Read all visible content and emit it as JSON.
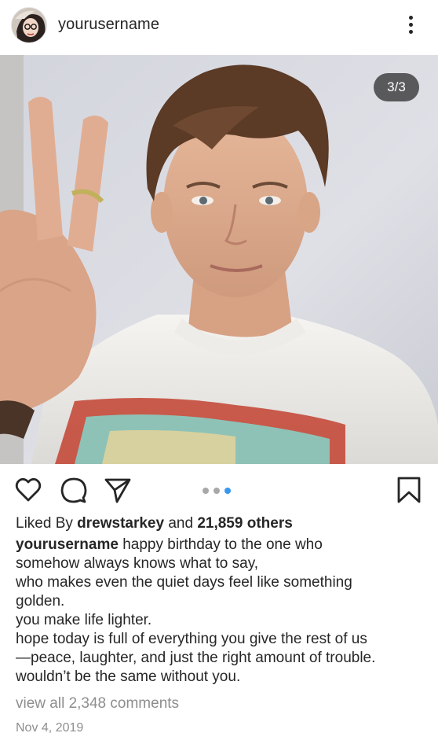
{
  "header": {
    "username": "yourusername"
  },
  "post": {
    "counter": "3/3",
    "carousel": {
      "total": 3,
      "active": 3
    }
  },
  "likes": {
    "prefix": "Liked By",
    "user": "drewstarkey",
    "connector": "and",
    "others": "21,859 others"
  },
  "caption": {
    "username": "yourusername",
    "lines": [
      "happy birthday to the one who",
      "somehow always knows what to say,",
      "who makes even the quiet days feel like something",
      "golden.",
      "you make life lighter.",
      "hope today is full of everything you give the rest of us",
      "—peace, laughter, and just the right amount of trouble.",
      "wouldn’t be the same without you."
    ]
  },
  "comments_link": "view all 2,348 comments",
  "date": "Nov 4, 2019",
  "icons": {
    "more": "more-vertical-icon",
    "like": "heart-icon",
    "comment": "comment-icon",
    "share": "send-icon",
    "save": "bookmark-icon"
  },
  "colors": {
    "text": "#262626",
    "muted": "#8e8e8e",
    "dot_inactive": "#a8a8a8",
    "dot_active": "#3897f0"
  }
}
